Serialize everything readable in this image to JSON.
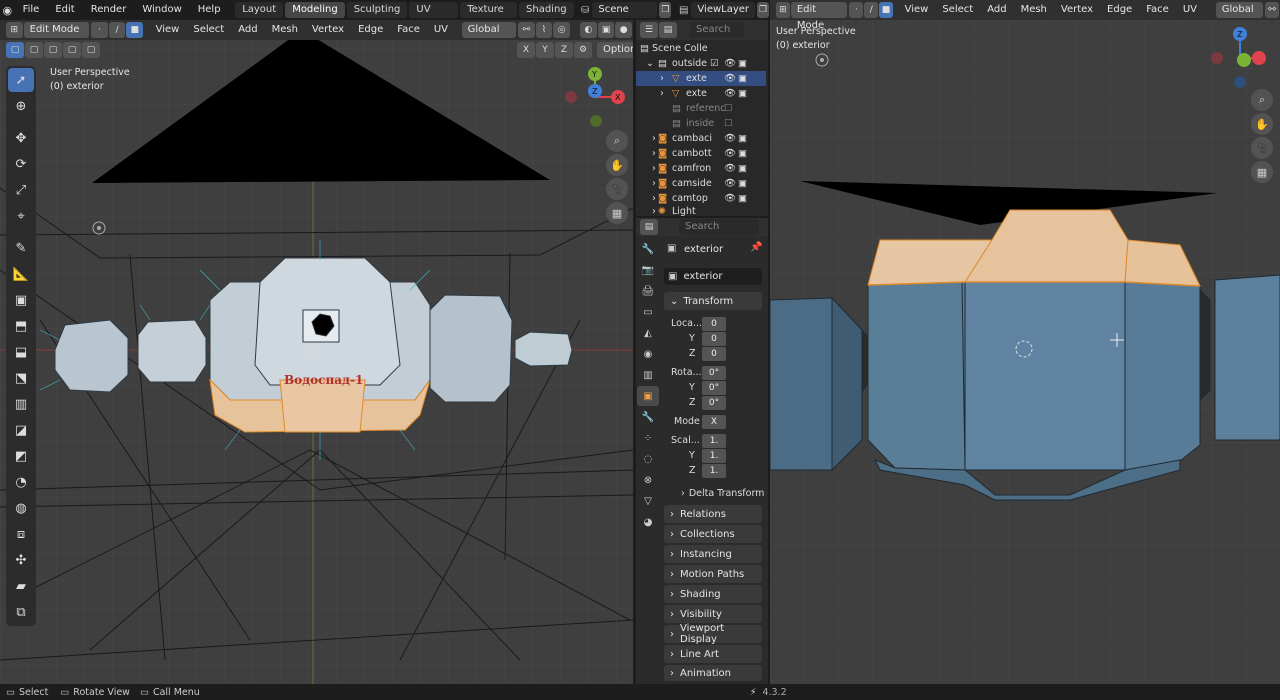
{
  "menu": [
    "File",
    "Edit",
    "Render",
    "Window",
    "Help"
  ],
  "workspaces": [
    "Layout",
    "Modeling",
    "Sculpting",
    "UV Editing",
    "Texture Paint",
    "Shading"
  ],
  "active_workspace": "Modeling",
  "scene": "Scene",
  "view_layer": "ViewLayer",
  "left_header": {
    "mode": "Edit Mode",
    "items": [
      "View",
      "Select",
      "Add",
      "Mesh",
      "Vertex",
      "Edge",
      "Face",
      "UV"
    ],
    "orientation": "Global"
  },
  "left_viewport": {
    "title": "User Perspective",
    "object": "(0) exterior",
    "axes": [
      "X",
      "Y",
      "Z"
    ],
    "options": "Options",
    "label_on_model": "Водоспад-1"
  },
  "right_header": {
    "mode": "Edit Mode",
    "items": [
      "View",
      "Select",
      "Add",
      "Mesh",
      "Vertex",
      "Edge",
      "Face",
      "UV"
    ],
    "orientation": "Global"
  },
  "right_viewport": {
    "title": "User Perspective",
    "object": "(0) exterior"
  },
  "outliner": {
    "search_placeholder": "Search",
    "rows": [
      {
        "name": "Scene Colle",
        "indent": 0,
        "kind": "collection"
      },
      {
        "name": "outside",
        "indent": 1,
        "kind": "collection"
      },
      {
        "name": "exte",
        "indent": 2,
        "kind": "mesh",
        "selected": true
      },
      {
        "name": "exte",
        "indent": 2,
        "kind": "mesh"
      },
      {
        "name": "referenc",
        "indent": 1,
        "kind": "collection",
        "dim": true
      },
      {
        "name": "inside",
        "indent": 1,
        "kind": "collection",
        "dim": true
      },
      {
        "name": "cambaci",
        "indent": 1,
        "kind": "camera"
      },
      {
        "name": "cambott",
        "indent": 1,
        "kind": "camera"
      },
      {
        "name": "camfron",
        "indent": 1,
        "kind": "camera"
      },
      {
        "name": "camside",
        "indent": 1,
        "kind": "camera"
      },
      {
        "name": "camtop",
        "indent": 1,
        "kind": "camera"
      },
      {
        "name": "Light",
        "indent": 1,
        "kind": "light"
      }
    ]
  },
  "properties": {
    "search_placeholder": "Search",
    "object_name": "exterior",
    "data_name": "exterior",
    "transform_label": "Transform",
    "location_label": "Loca...",
    "location": [
      "0",
      "0",
      "0"
    ],
    "rotation_label": "Rota...",
    "rotation": [
      "0°",
      "0°",
      "0°"
    ],
    "mode_label": "Mode",
    "mode_value": "X",
    "scale_label": "Scal...",
    "scale": [
      "1.",
      "1.",
      "1."
    ],
    "axis_y": "Y",
    "axis_z": "Z",
    "delta_transform": "Delta Transform",
    "panels": [
      "Relations",
      "Collections",
      "Instancing",
      "Motion Paths",
      "Shading",
      "Visibility",
      "Viewport Display",
      "Line Art",
      "Animation"
    ]
  },
  "status": {
    "select": "Select",
    "rotate": "Rotate View",
    "menu": "Call Menu",
    "version": "4.3.2"
  }
}
